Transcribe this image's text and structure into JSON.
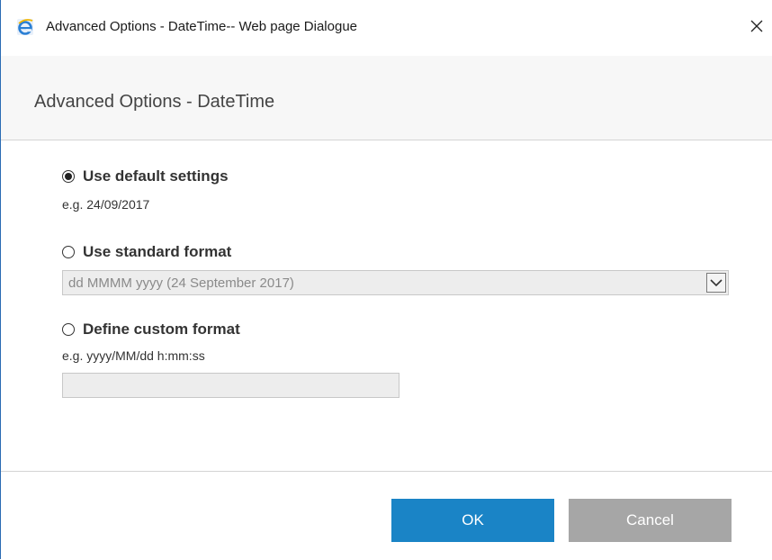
{
  "window": {
    "title": "Advanced Options - DateTime-- Web page Dialogue",
    "icon": "internet-explorer-icon",
    "close_icon": "close-icon"
  },
  "dialog": {
    "title": "Advanced Options - DateTime"
  },
  "options": {
    "default": {
      "label": "Use default settings",
      "example": "e.g. 24/09/2017",
      "selected": true
    },
    "standard": {
      "label": "Use standard format",
      "selected": false,
      "select_value": "dd MMMM yyyy (24 September 2017)",
      "select_icon": "chevron-down-icon"
    },
    "custom": {
      "label": "Define custom format",
      "example": "e.g. yyyy/MM/dd h:mm:ss",
      "selected": false,
      "input_value": ""
    }
  },
  "footer": {
    "ok_label": "OK",
    "cancel_label": "Cancel"
  },
  "colors": {
    "ok_button": "#1a84c6",
    "cancel_button": "#a6a6a6",
    "header_bg": "#f7f7f7"
  }
}
